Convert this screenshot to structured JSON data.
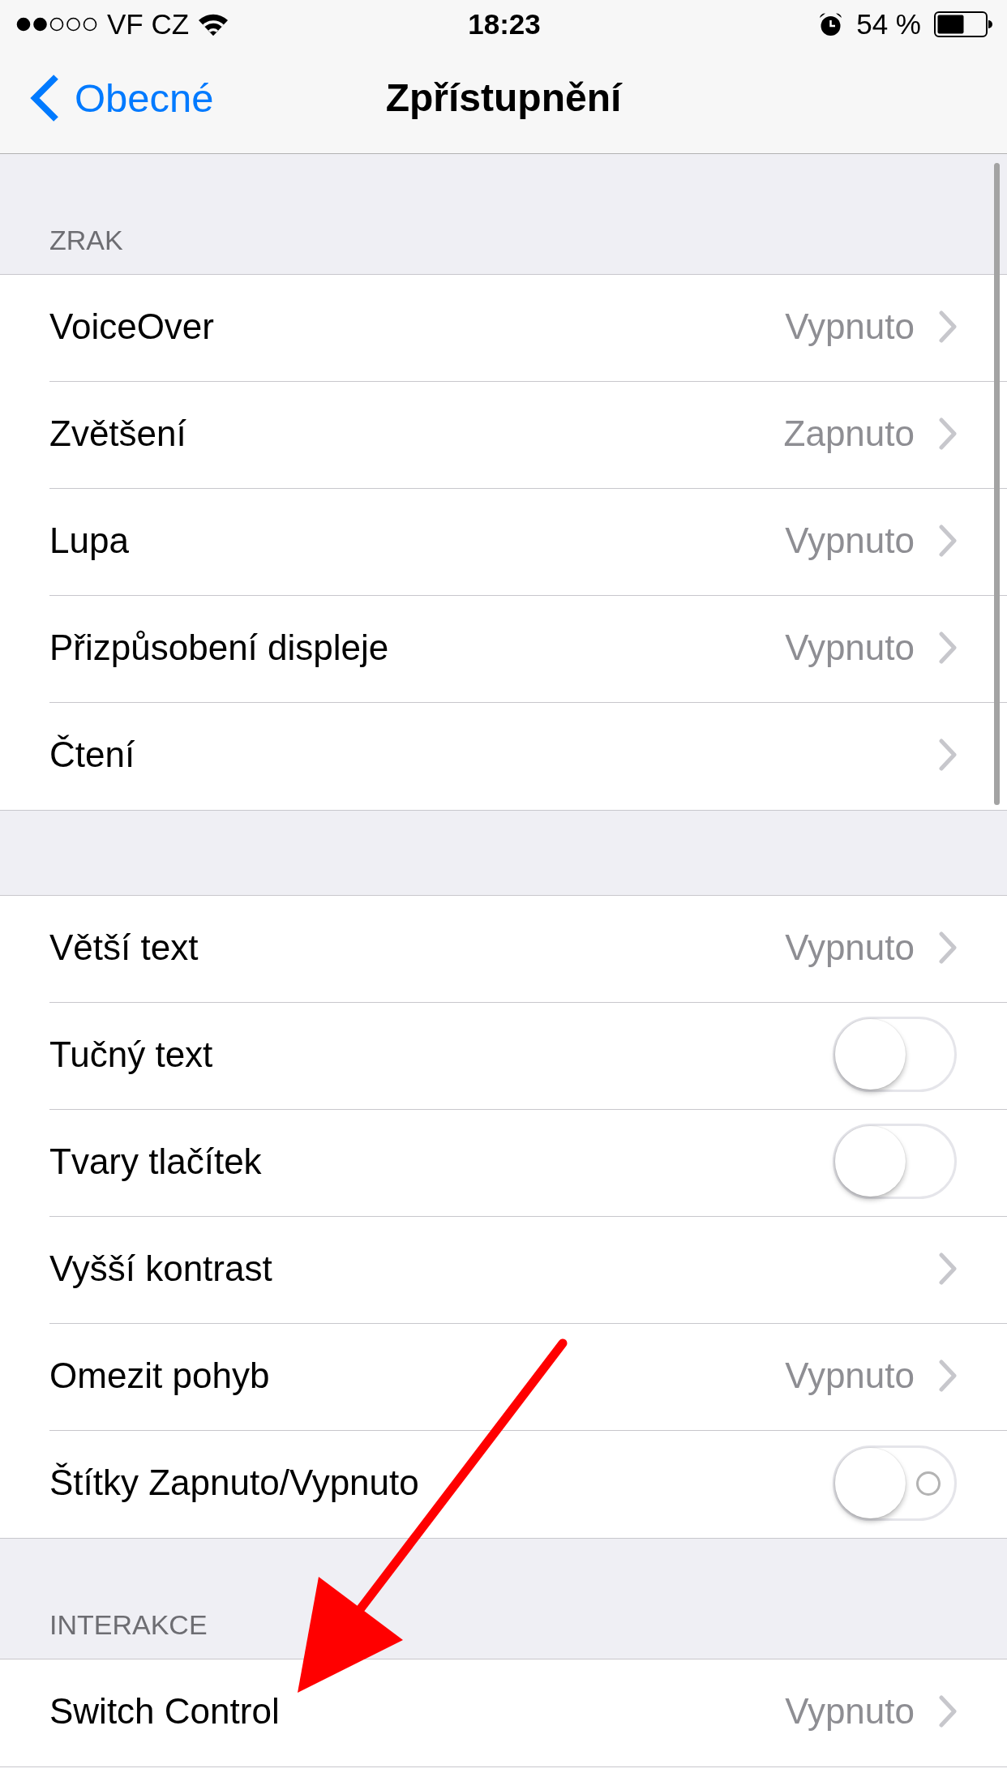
{
  "status_bar": {
    "carrier": "VF CZ",
    "time": "18:23",
    "battery": "54 %"
  },
  "nav": {
    "back": "Obecné",
    "title": "Zpřístupnění"
  },
  "sections": [
    {
      "header": "ZRAK",
      "rows": [
        {
          "kind": "link",
          "label": "VoiceOver",
          "value": "Vypnuto"
        },
        {
          "kind": "link",
          "label": "Zvětšení",
          "value": "Zapnuto"
        },
        {
          "kind": "link",
          "label": "Lupa",
          "value": "Vypnuto"
        },
        {
          "kind": "link",
          "label": "Přizpůsobení displeje",
          "value": "Vypnuto"
        },
        {
          "kind": "link",
          "label": "Čtení"
        }
      ]
    },
    {
      "rows": [
        {
          "kind": "link",
          "label": "Větší text",
          "value": "Vypnuto"
        },
        {
          "kind": "toggle",
          "label": "Tučný text",
          "on": false,
          "show_label": false
        },
        {
          "kind": "toggle",
          "label": "Tvary tlačítek",
          "on": false,
          "show_label": false
        },
        {
          "kind": "link",
          "label": "Vyšší kontrast"
        },
        {
          "kind": "link",
          "label": "Omezit pohyb",
          "value": "Vypnuto"
        },
        {
          "kind": "toggle",
          "label": "Štítky Zapnuto/Vypnuto",
          "on": false,
          "show_label": true
        }
      ]
    },
    {
      "header": "INTERAKCE",
      "rows": [
        {
          "kind": "link",
          "label": "Switch Control",
          "value": "Vypnuto"
        }
      ]
    }
  ]
}
